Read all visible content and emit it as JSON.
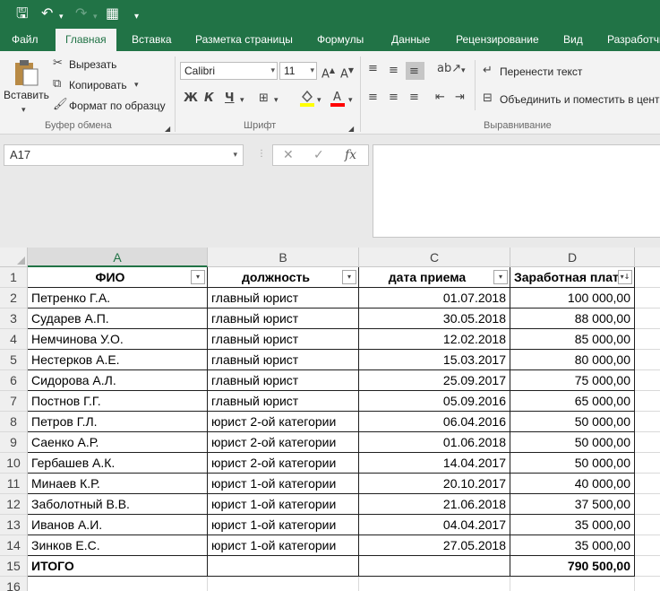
{
  "qat": {
    "save_icon": "save-icon",
    "undo_icon": "undo-icon",
    "redo_icon": "redo-icon",
    "layout_icon": "table-layout-icon",
    "customize_icon": "customize-icon"
  },
  "tabs": [
    "Файл",
    "Главная",
    "Вставка",
    "Разметка страницы",
    "Формулы",
    "Данные",
    "Рецензирование",
    "Вид",
    "Разработчик"
  ],
  "active_tab": "Главная",
  "ribbon": {
    "clipboard": {
      "paste": "Вставить",
      "cut": "Вырезать",
      "copy": "Копировать",
      "format_painter": "Формат по образцу",
      "group": "Буфер обмена"
    },
    "font": {
      "name": "Calibri",
      "size": "11",
      "bold": "Ж",
      "italic": "К",
      "underline": "Ч",
      "group": "Шрифт"
    },
    "alignment": {
      "wrap": "Перенести текст",
      "merge": "Объединить и поместить в центре",
      "group": "Выравнивание"
    }
  },
  "formula_bar": {
    "name_box": "A17",
    "value": ""
  },
  "columns": [
    "A",
    "B",
    "C",
    "D"
  ],
  "header_row": [
    "ФИО",
    "должность",
    "дата приема",
    "Заработная плата"
  ],
  "rows": [
    [
      "Петренко Г.А.",
      "главный юрист",
      "01.07.2018",
      "100 000,00"
    ],
    [
      "Сударев А.П.",
      "главный юрист",
      "30.05.2018",
      "88 000,00"
    ],
    [
      "Немчинова У.О.",
      "главный юрист",
      "12.02.2018",
      "85 000,00"
    ],
    [
      "Нестерков А.Е.",
      "главный юрист",
      "15.03.2017",
      "80 000,00"
    ],
    [
      "Сидорова А.Л.",
      "главный юрист",
      "25.09.2017",
      "75 000,00"
    ],
    [
      "Постнов Г.Г.",
      "главный юрист",
      "05.09.2016",
      "65 000,00"
    ],
    [
      "Петров Г.Л.",
      "юрист 2-ой категории",
      "06.04.2016",
      "50 000,00"
    ],
    [
      "Саенко А.Р.",
      "юрист 2-ой категории",
      "01.06.2018",
      "50 000,00"
    ],
    [
      "Гербашев А.К.",
      "юрист 2-ой категории",
      "14.04.2017",
      "50 000,00"
    ],
    [
      "Минаев К.Р.",
      "юрист 1-ой категории",
      "20.10.2017",
      "40 000,00"
    ],
    [
      "Заболотный В.В.",
      "юрист 1-ой категории",
      "21.06.2018",
      "37 500,00"
    ],
    [
      "Иванов А.И.",
      "юрист 1-ой категории",
      "04.04.2017",
      "35 000,00"
    ],
    [
      "Зинков Е.С.",
      "юрист 1-ой категории",
      "27.05.2018",
      "35 000,00"
    ]
  ],
  "total_row": [
    "ИТОГО",
    "",
    "",
    "790 500,00"
  ],
  "row_numbers": [
    "1",
    "2",
    "3",
    "4",
    "5",
    "6",
    "7",
    "8",
    "9",
    "10",
    "11",
    "12",
    "13",
    "14",
    "15",
    "16"
  ],
  "colors": {
    "accent": "#217346",
    "ribbon_bg": "#f3f3f3",
    "grid_header": "#efefef"
  }
}
